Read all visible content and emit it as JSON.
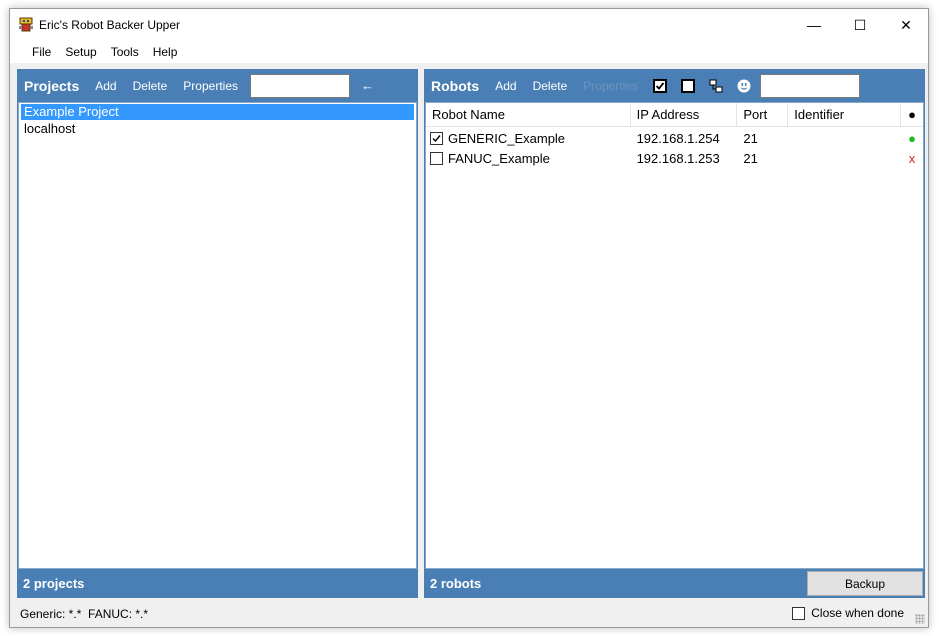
{
  "window": {
    "title": "Eric's Robot Backer Upper",
    "min_glyph": "—",
    "max_glyph": "☐",
    "close_glyph": "✕"
  },
  "menu": [
    "File",
    "Setup",
    "Tools",
    "Help"
  ],
  "projects": {
    "title": "Projects",
    "add_label": "Add",
    "delete_label": "Delete",
    "properties_label": "Properties",
    "search_value": "",
    "arrow_glyph": "←",
    "items": [
      "Example Project",
      "localhost"
    ],
    "selected_index": 0,
    "footer": "2 projects"
  },
  "robots": {
    "title": "Robots",
    "add_label": "Add",
    "delete_label": "Delete",
    "properties_label": "Properties",
    "search_value": "",
    "columns": [
      "Robot Name",
      "IP Address",
      "Port",
      "Identifier",
      "●"
    ],
    "rows": [
      {
        "checked": true,
        "name": "GENERIC_Example",
        "ip": "192.168.1.254",
        "port": "21",
        "identifier": "",
        "status": "●",
        "status_ok": true
      },
      {
        "checked": false,
        "name": "FANUC_Example",
        "ip": "192.168.1.253",
        "port": "21",
        "identifier": "",
        "status": "x",
        "status_ok": false
      }
    ],
    "footer": "2 robots",
    "backup_label": "Backup"
  },
  "statusbar": {
    "filters": "Generic: *.*  FANUC: *.*",
    "close_when_done_label": "Close when done",
    "close_when_done_checked": false
  },
  "colors": {
    "panel_blue": "#4a7fb5",
    "selection_blue": "#3399ff",
    "status_ok": "#22bb22",
    "status_bad": "#dd2222"
  }
}
